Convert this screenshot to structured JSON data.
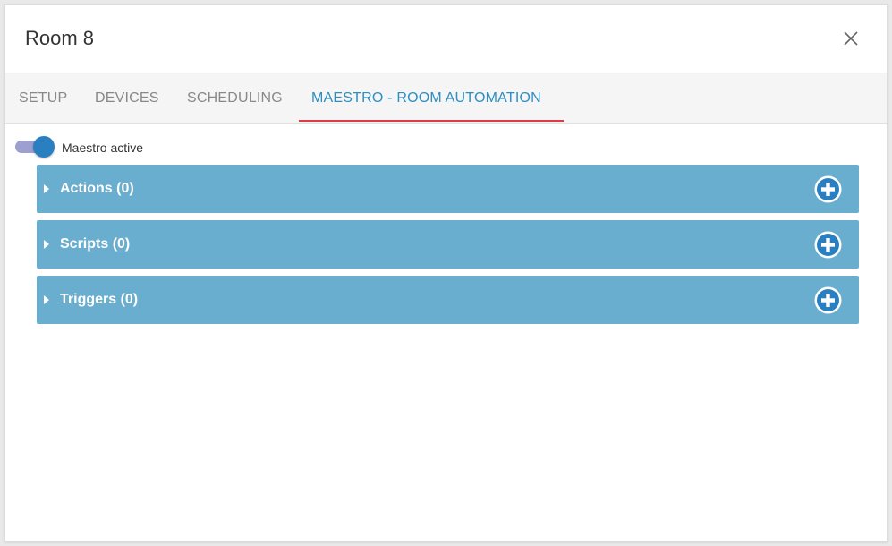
{
  "dialog": {
    "title": "Room 8",
    "close_icon": "close-icon"
  },
  "tabs": [
    {
      "label": "SETUP",
      "active": false
    },
    {
      "label": "DEVICES",
      "active": false
    },
    {
      "label": "SCHEDULING",
      "active": false
    },
    {
      "label": "MAESTRO - ROOM AUTOMATION",
      "active": true
    }
  ],
  "maestro_toggle": {
    "label": "Maestro active",
    "on": true
  },
  "panels": [
    {
      "label": "Actions (0)",
      "icon": "plus-circle-icon"
    },
    {
      "label": "Scripts (0)",
      "icon": "plus-circle-icon"
    },
    {
      "label": "Triggers (0)",
      "icon": "plus-circle-icon"
    }
  ],
  "colors": {
    "accent": "#2d8ec1",
    "tab_underline": "#e03a44",
    "panel_bg": "#69aecf",
    "toggle_track": "#9c9fd0",
    "toggle_knob": "#2a7fc0"
  }
}
